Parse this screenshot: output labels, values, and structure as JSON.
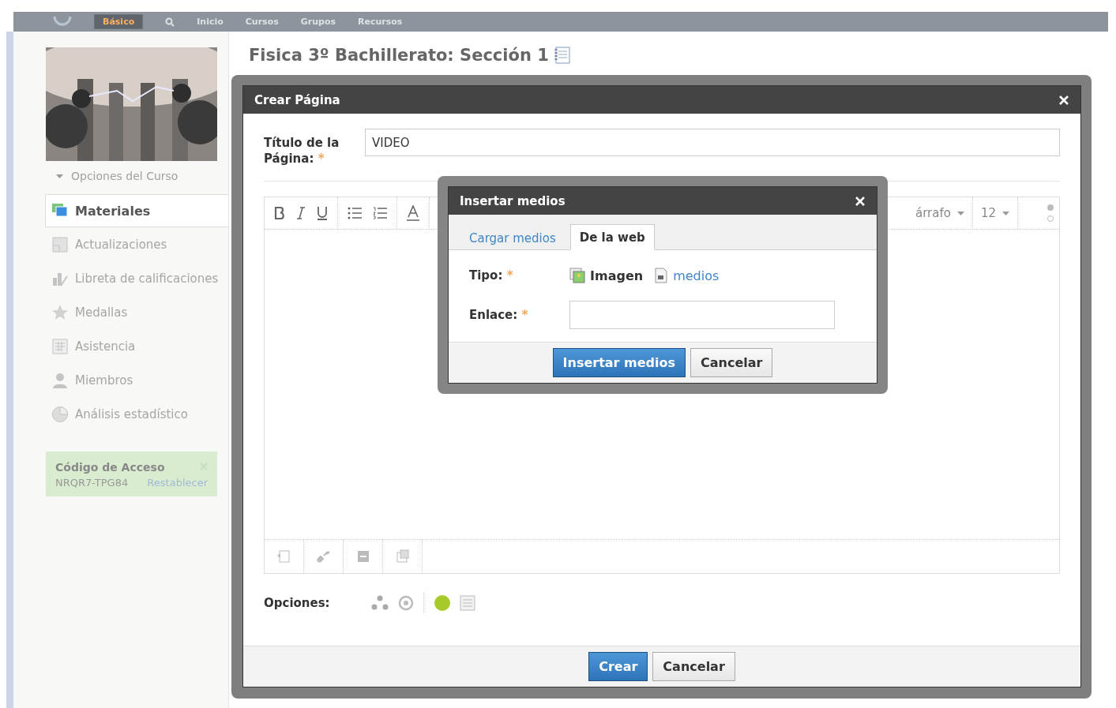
{
  "top_nav": {
    "mode": "Básico",
    "items": [
      "Inicio",
      "Cursos",
      "Grupos",
      "Recursos"
    ]
  },
  "sidebar": {
    "options_label": "Opciones del Curso",
    "items": [
      {
        "label": "Materiales",
        "selected": true
      },
      {
        "label": "Actualizaciones",
        "selected": false
      },
      {
        "label": "Libreta de calificaciones",
        "selected": false
      },
      {
        "label": "Medallas",
        "selected": false
      },
      {
        "label": "Asistencia",
        "selected": false
      },
      {
        "label": "Miembros",
        "selected": false
      },
      {
        "label": "Análisis estadístico",
        "selected": false
      }
    ],
    "access_code": {
      "title": "Código de Acceso",
      "code": "NRQR7-TPG84",
      "reset": "Restablecer"
    }
  },
  "page_title": "Fisica 3º Bachillerato: Sección 1",
  "dialog": {
    "title": "Crear Página",
    "title_label": "Título de la Página:",
    "required_mark": "*",
    "title_value": "VIDEO",
    "paragraph": "árrafo",
    "size": "12",
    "options_label": "Opciones:",
    "buttons": [
      "Crear",
      "Cancelar"
    ]
  },
  "media_dialog": {
    "title": "Insertar medios",
    "tabs": [
      {
        "label": "Cargar medios",
        "selected": false
      },
      {
        "label": "De la web",
        "selected": true
      }
    ],
    "type_label": "Tipo:",
    "type_mark": "*",
    "types": [
      {
        "label": "Imagen",
        "selected": true
      },
      {
        "label": "medios",
        "selected": false
      }
    ],
    "link_label": "Enlace:",
    "link_mark": "*",
    "buttons": [
      "Insertar medios",
      "Cancelar"
    ]
  }
}
